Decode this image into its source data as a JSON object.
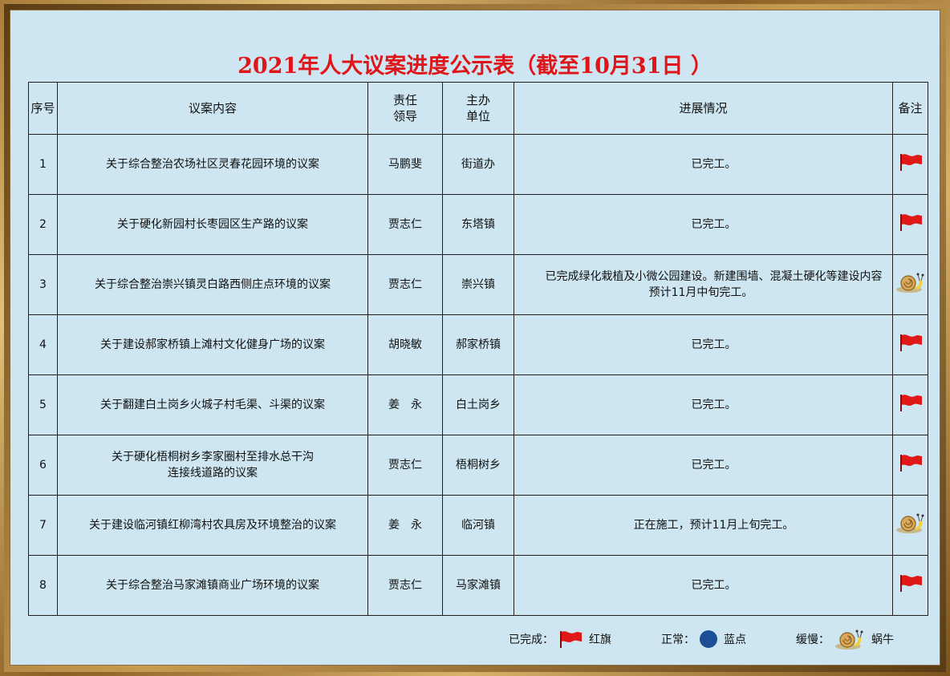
{
  "title": "2021年人大议案进度公示表（截至10月31日 ）",
  "headers": {
    "seq": "序号",
    "content": "议案内容",
    "leader_l1": "责任",
    "leader_l2": "领导",
    "unit_l1": "主办",
    "unit_l2": "单位",
    "progress": "进展情况",
    "note": "备注"
  },
  "rows": [
    {
      "seq": "1",
      "content": "关于综合整治农场社区灵春花园环境的议案",
      "leader": "马鹏斐",
      "unit": "街道办",
      "progress": "已完工。",
      "status_icon": "red-flag-icon"
    },
    {
      "seq": "2",
      "content": "关于硬化新园村长枣园区生产路的议案",
      "leader": "贾志仁",
      "unit": "东塔镇",
      "progress": "已完工。",
      "status_icon": "red-flag-icon"
    },
    {
      "seq": "3",
      "content": "关于综合整治崇兴镇灵白路西侧庄点环境的议案",
      "leader": "贾志仁",
      "unit": "崇兴镇",
      "progress": "已完成绿化栽植及小微公园建设。新建围墙、混凝土硬化等建设内容预计11月中旬完工。",
      "status_icon": "snail-icon"
    },
    {
      "seq": "4",
      "content": "关于建设郝家桥镇上滩村文化健身广场的议案",
      "leader": "胡晓敏",
      "unit": "郝家桥镇",
      "progress": "已完工。",
      "status_icon": "red-flag-icon"
    },
    {
      "seq": "5",
      "content": "关于翻建白土岗乡火城子村毛渠、斗渠的议案",
      "leader": "姜　永",
      "unit": "白土岗乡",
      "progress": "已完工。",
      "status_icon": "red-flag-icon"
    },
    {
      "seq": "6",
      "content": "关于硬化梧桐树乡李家圈村至排水总干沟",
      "content_line2": "连接线道路的议案",
      "leader": "贾志仁",
      "unit": "梧桐树乡",
      "progress": "已完工。",
      "status_icon": "red-flag-icon"
    },
    {
      "seq": "7",
      "content": "关于建设临河镇红柳湾村农具房及环境整治的议案",
      "leader": "姜　永",
      "unit": "临河镇",
      "progress": "正在施工，预计11月上旬完工。",
      "status_icon": "snail-icon"
    },
    {
      "seq": "8",
      "content": "关于综合整治马家滩镇商业广场环境的议案",
      "leader": "贾志仁",
      "unit": "马家滩镇",
      "progress": "已完工。",
      "status_icon": "red-flag-icon"
    }
  ],
  "legend": {
    "done_label": "已完成：",
    "done_name": "红旗",
    "normal_label": "正常：",
    "normal_name": "蓝点",
    "slow_label": "缓慢：",
    "slow_name": "蜗牛"
  },
  "colors": {
    "title": "#e0151a",
    "background": "#cde6f1",
    "flag": "#e01818",
    "dot": "#1d4f96"
  }
}
